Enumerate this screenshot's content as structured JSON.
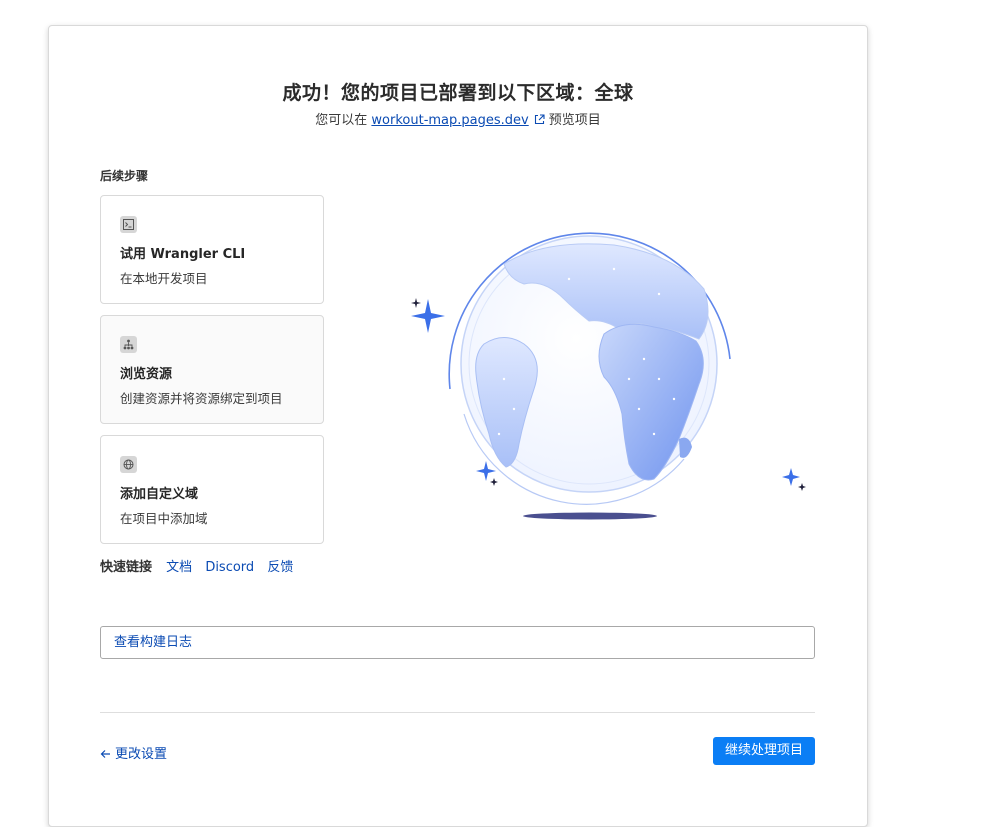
{
  "header": {
    "title": "成功！您的项目已部署到以下区域：全球",
    "subtitle_prefix": "您可以在",
    "preview_link": "workout-map.pages.dev",
    "subtitle_suffix": "预览项目"
  },
  "next_steps": {
    "label": "后续步骤",
    "items": [
      {
        "icon": "terminal-icon",
        "title": "试用 Wrangler CLI",
        "desc": "在本地开发项目"
      },
      {
        "icon": "hierarchy-icon",
        "title": "浏览资源",
        "desc": "创建资源并将资源绑定到项目"
      },
      {
        "icon": "globe-icon",
        "title": "添加自定义域",
        "desc": "在项目中添加域"
      }
    ]
  },
  "quick_links": {
    "label": "快速链接",
    "links": [
      "文档",
      "Discord",
      "反馈"
    ]
  },
  "build_log_button": "查看构建日志",
  "footer": {
    "back_label": "更改设置",
    "primary_label": "继续处理项目"
  },
  "colors": {
    "accent": "#0b7ef5",
    "link": "#0b4bb3",
    "globe": "#7a9ff0"
  }
}
